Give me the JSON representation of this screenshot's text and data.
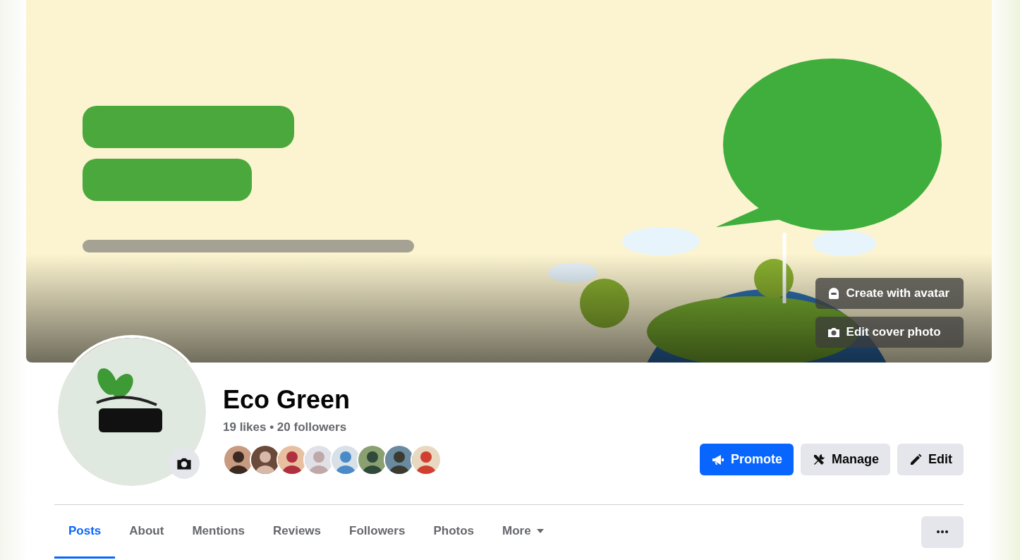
{
  "cover": {
    "kind": "picture",
    "buttons": [
      {
        "kind": "avatar",
        "label": "Create with avatar"
      },
      {
        "kind": "camera",
        "label": "Edit cover photo"
      }
    ]
  },
  "profile": {
    "name": "Eco Green",
    "stats": "19 likes • 20 followers"
  },
  "actions": [
    {
      "kind": "promote",
      "label": "Promote",
      "primary": true
    },
    {
      "kind": "manage",
      "label": "Manage",
      "primary": false
    },
    {
      "kind": "edit",
      "label": "Edit",
      "primary": false
    }
  ],
  "tabs": [
    {
      "label": "Posts",
      "selected": true,
      "kind": "tab"
    },
    {
      "label": "About",
      "selected": false,
      "kind": "tab"
    },
    {
      "label": "Mentions",
      "selected": false,
      "kind": "tab"
    },
    {
      "label": "Reviews",
      "selected": false,
      "kind": "tab"
    },
    {
      "label": "Followers",
      "selected": false,
      "kind": "tab"
    },
    {
      "label": "Photos",
      "selected": false,
      "kind": "tab"
    },
    {
      "label": "More",
      "selected": false,
      "kind": "menu"
    }
  ]
}
